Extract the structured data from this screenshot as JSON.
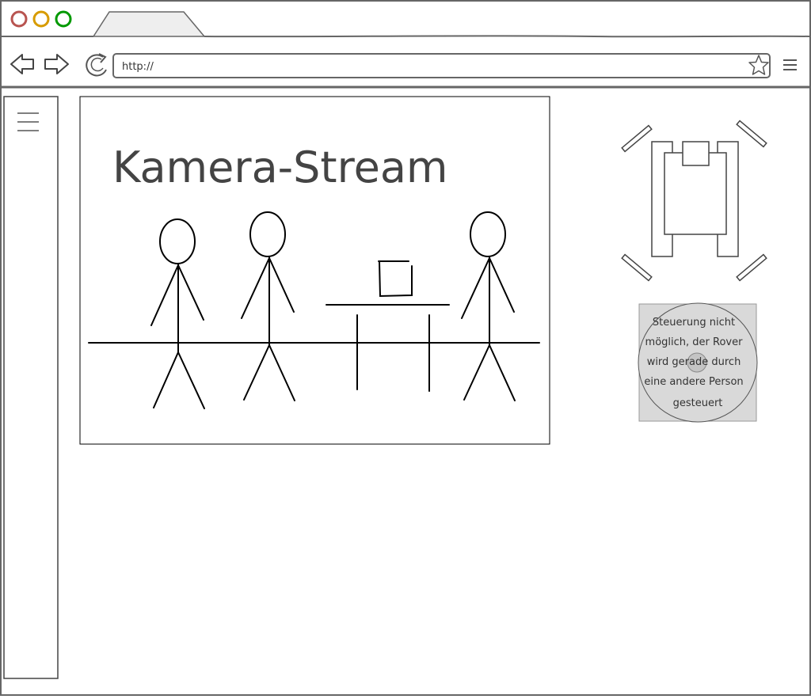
{
  "browser": {
    "url": "http://"
  },
  "stream": {
    "title": "Kamera-Stream"
  },
  "control": {
    "message_lines": [
      "Steuerung nicht",
      "möglich, der Rover",
      "wird gerade durch",
      "eine andere Person",
      "gesteuert"
    ]
  },
  "icons": {
    "close": "circle-red",
    "minimize": "circle-orange",
    "maximize": "circle-green",
    "back": "arrow-left",
    "forward": "arrow-right",
    "reload": "circular-arrow",
    "bookmark": "star",
    "browser_menu": "hamburger",
    "sidebar_menu": "hamburger"
  },
  "colors": {
    "close": "#b85450",
    "minimize": "#d79b00",
    "maximize": "#009900",
    "stroke": "#666666",
    "ink": "#000000",
    "joystick_fill": "#d9d9d9"
  }
}
